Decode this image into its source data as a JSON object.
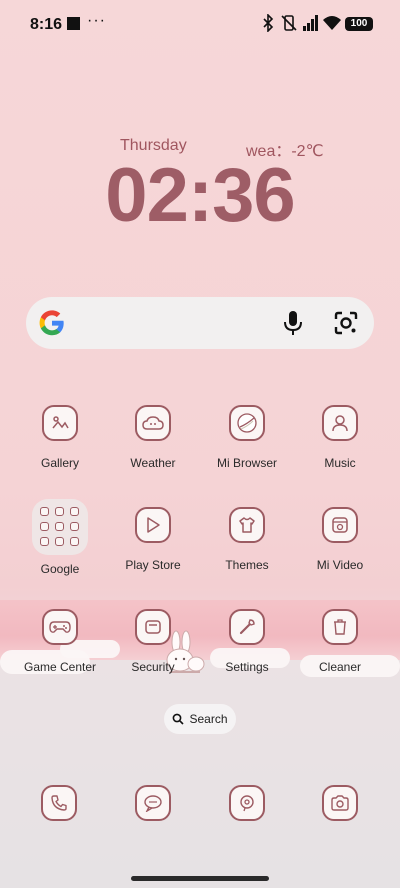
{
  "status_bar": {
    "time": "8:16",
    "more": "···",
    "battery": "100"
  },
  "clock_widget": {
    "day": "Thursday",
    "weather": "wea：-2℃",
    "time": "02:36"
  },
  "google_search": {
    "logo": "google-g-icon",
    "mic": "mic-icon",
    "lens": "lens-icon"
  },
  "apps": [
    {
      "label": "Gallery",
      "icon": "gallery-icon"
    },
    {
      "label": "Weather",
      "icon": "weather-icon"
    },
    {
      "label": "Mi Browser",
      "icon": "browser-icon"
    },
    {
      "label": "Music",
      "icon": "music-icon"
    },
    {
      "label": "Google",
      "icon": "folder-icon"
    },
    {
      "label": "Play Store",
      "icon": "play-store-icon"
    },
    {
      "label": "Themes",
      "icon": "themes-icon"
    },
    {
      "label": "Mi Video",
      "icon": "video-icon"
    },
    {
      "label": "Game Center",
      "icon": "game-center-icon"
    },
    {
      "label": "Security",
      "icon": "security-icon"
    },
    {
      "label": "Settings",
      "icon": "settings-icon"
    },
    {
      "label": "Cleaner",
      "icon": "cleaner-icon"
    }
  ],
  "search_pill": {
    "label": "Search"
  },
  "dock": [
    "phone-icon",
    "messages-icon",
    "chrome-icon",
    "camera-icon"
  ],
  "colors": {
    "accent": "#9c5b62",
    "wallpaper": "#f6d7d8",
    "clock": "#9e5d66"
  }
}
